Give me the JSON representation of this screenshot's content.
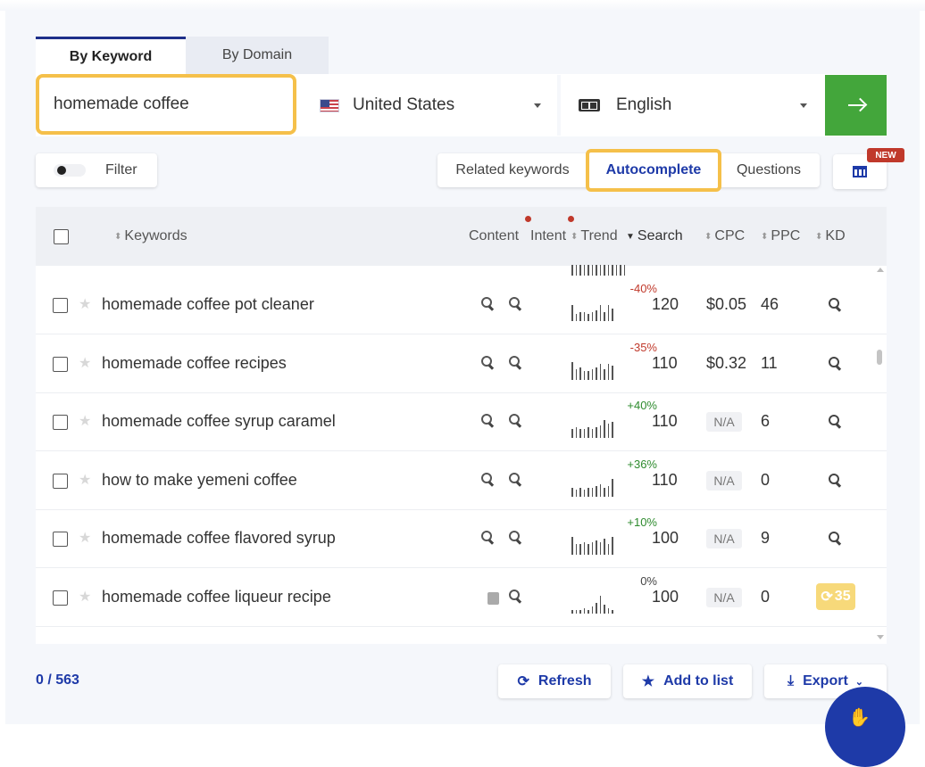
{
  "tabs": {
    "by_keyword": "By Keyword",
    "by_domain": "By Domain"
  },
  "search": {
    "keyword_value": "homemade coffee",
    "country": "United States",
    "language": "English"
  },
  "filter_label": "Filter",
  "modes": {
    "related": "Related keywords",
    "autocomplete": "Autocomplete",
    "questions": "Questions",
    "new_badge": "NEW"
  },
  "columns": {
    "keywords": "Keywords",
    "content": "Content",
    "intent": "Intent",
    "trend": "Trend",
    "search": "Search",
    "cpc": "CPC",
    "ppc": "PPC",
    "kd": "KD"
  },
  "rows": [
    {
      "keyword": "homemade coffee pot cleaner",
      "trend_pct": "-40%",
      "trend_color": "#c0392b",
      "search": "120",
      "cpc": "$0.05",
      "ppc": "46",
      "spark": [
        0.9,
        0.4,
        0.5,
        0.5,
        0.4,
        0.5,
        0.6,
        0.9,
        0.5,
        0.9,
        0.7
      ]
    },
    {
      "keyword": "homemade coffee recipes",
      "trend_pct": "-35%",
      "trend_color": "#c0392b",
      "search": "110",
      "cpc": "$0.32",
      "ppc": "11",
      "spark": [
        1.0,
        0.6,
        0.7,
        0.5,
        0.5,
        0.6,
        0.7,
        0.9,
        0.6,
        0.9,
        0.8
      ]
    },
    {
      "keyword": "homemade coffee syrup caramel",
      "trend_pct": "+40%",
      "trend_color": "#2e8b2e",
      "search": "110",
      "cpc": "N/A",
      "ppc": "6",
      "spark": [
        0.5,
        0.6,
        0.5,
        0.5,
        0.6,
        0.5,
        0.6,
        0.7,
        1.0,
        0.8,
        0.9
      ]
    },
    {
      "keyword": "how to make yemeni coffee",
      "trend_pct": "+36%",
      "trend_color": "#2e8b2e",
      "search": "110",
      "cpc": "N/A",
      "ppc": "0",
      "spark": [
        0.5,
        0.4,
        0.5,
        0.4,
        0.5,
        0.5,
        0.6,
        0.7,
        0.5,
        0.6,
        1.0
      ]
    },
    {
      "keyword": "homemade coffee flavored syrup",
      "trend_pct": "+10%",
      "trend_color": "#2e8b2e",
      "search": "100",
      "cpc": "N/A",
      "ppc": "9",
      "spark": [
        1.0,
        0.6,
        0.6,
        0.7,
        0.6,
        0.7,
        0.8,
        0.7,
        0.9,
        0.6,
        1.0
      ]
    },
    {
      "keyword": "homemade coffee liqueur recipe",
      "trend_pct": "0%",
      "trend_color": "#444444",
      "search": "100",
      "cpc": "N/A",
      "ppc": "0",
      "kd": "35",
      "spark": [
        0.2,
        0.2,
        0.2,
        0.3,
        0.2,
        0.4,
        0.6,
        1.0,
        0.5,
        0.3,
        0.2
      ]
    }
  ],
  "footer": {
    "counter": "0 / 563",
    "refresh": "Refresh",
    "add_to_list": "Add to list",
    "export": "Export"
  },
  "colors": {
    "accent_blue": "#1e3aa8",
    "highlight": "#f5c04a",
    "go_green": "#43a63b"
  }
}
